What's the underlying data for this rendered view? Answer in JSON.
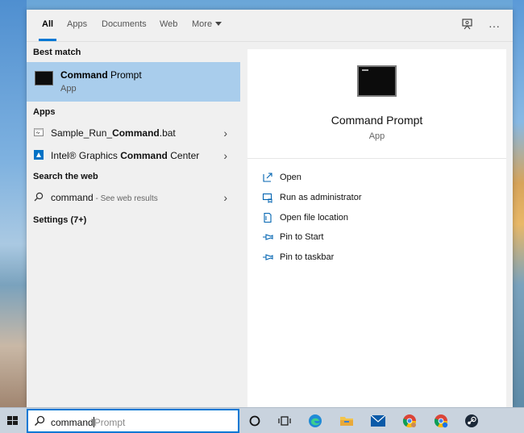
{
  "tabs": {
    "all": "All",
    "apps": "Apps",
    "documents": "Documents",
    "web": "Web",
    "more": "More"
  },
  "top_icons": {
    "feedback": "feedback-icon",
    "more": "···"
  },
  "left": {
    "best_match_heading": "Best match",
    "best_match": {
      "title_bold": "Command",
      "title_rest": " Prompt",
      "subtitle": "App"
    },
    "apps_heading": "Apps",
    "apps": [
      {
        "pre": "Sample_Run_",
        "bold": "Command",
        "post": ".bat"
      },
      {
        "pre": "Intel® Graphics ",
        "bold": "Command",
        "post": " Center"
      }
    ],
    "web_heading": "Search the web",
    "web_query": "command",
    "web_hint": " - See web results",
    "settings_heading": "Settings (7+)"
  },
  "right": {
    "title": "Command Prompt",
    "subtitle": "App",
    "actions": [
      {
        "label": "Open",
        "icon": "open-icon"
      },
      {
        "label": "Run as administrator",
        "icon": "shield-icon"
      },
      {
        "label": "Open file location",
        "icon": "file-location-icon"
      },
      {
        "label": "Pin to Start",
        "icon": "pin-icon"
      },
      {
        "label": "Pin to taskbar",
        "icon": "pin-icon"
      }
    ]
  },
  "taskbar": {
    "search_typed": "command",
    "search_suggestion": "Prompt",
    "icons": [
      "cortana-icon",
      "task-view-icon",
      "edge-icon",
      "file-explorer-icon",
      "mail-icon",
      "chrome-icon",
      "chrome-profile-icon",
      "steam-icon"
    ]
  },
  "colors": {
    "accent": "#0078d4",
    "selection": "#a9cdec",
    "action_icon": "#0063b1"
  }
}
